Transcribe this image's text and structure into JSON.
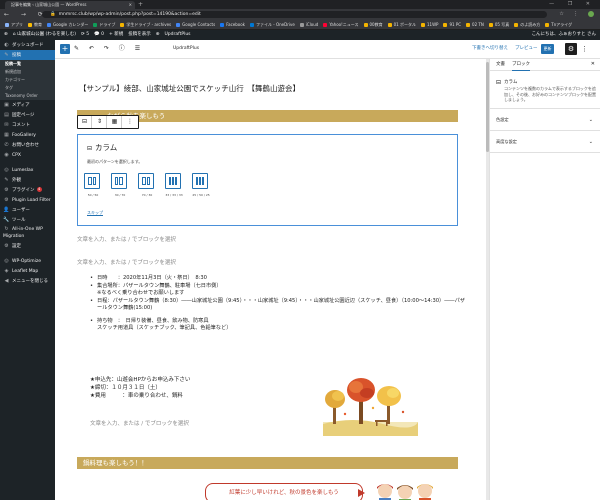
{
  "browser": {
    "tab_title": "記事を編集 ‹ 山家城山公園 — WordPress",
    "tab_close": "×",
    "new_tab": "+",
    "window_controls": "— ❐ ✕",
    "nav": "← → ⟳",
    "url": "mnmrsc.club/wp/wp-admin/post.php?post=14190&action=edit",
    "icons": "☆ ⋮",
    "bookmarks": [
      {
        "label": "アプリ",
        "color": "#8ab4f8"
      },
      {
        "label": "教育",
        "color": "#fbbc04"
      },
      {
        "label": "Google カレンダー",
        "color": "#4285f4"
      },
      {
        "label": "ドライブ",
        "color": "#0f9d58"
      },
      {
        "label": "学生ドライブ - archives",
        "color": "#f4b400"
      },
      {
        "label": "Google Contacts",
        "color": "#4285f4"
      },
      {
        "label": "Facebook",
        "color": "#1877f2"
      },
      {
        "label": "ファイル - OneDrive",
        "color": "#0078d4"
      },
      {
        "label": "iCloud",
        "color": "#999999"
      },
      {
        "label": "Yahoo!ニュース",
        "color": "#ff0033"
      },
      {
        "label": "00教育",
        "color": "#f4b400"
      },
      {
        "label": "01 ポータル",
        "color": "#f4b400"
      },
      {
        "label": "11WP",
        "color": "#f4b400"
      },
      {
        "label": "91 PC",
        "color": "#f4b400"
      },
      {
        "label": "02 TN",
        "color": "#f4b400"
      },
      {
        "label": "05 写真",
        "color": "#f4b400"
      },
      {
        "label": "のよ読み方",
        "color": "#f4b400"
      },
      {
        "label": "Tnアライグ",
        "color": "#f4b400"
      }
    ]
  },
  "adminbar": {
    "items": [
      "⊕",
      "⌂ 山家城山公園 (わるを楽しむ)",
      "⟳ 5",
      "💬 0",
      "+ 新規",
      "投稿を表示",
      "⊕",
      "UpdraftPlus"
    ],
    "greeting": "こんにちは、ふぁおりすと さん"
  },
  "sidebar": {
    "items": [
      {
        "icon": "◐",
        "label": "ダッシュボード",
        "state": "normal"
      },
      {
        "icon": "✎",
        "label": "投稿",
        "state": "active"
      },
      {
        "sub": true,
        "label": "投稿一覧",
        "cur": true
      },
      {
        "sub": true,
        "label": "新規追加"
      },
      {
        "sub": true,
        "label": "カテゴリー"
      },
      {
        "sub": true,
        "label": "タグ"
      },
      {
        "sub": true,
        "label": "Taxonomy Order"
      },
      {
        "icon": "▣",
        "label": "メディア"
      },
      {
        "icon": "▤",
        "label": "固定ページ"
      },
      {
        "icon": "✉",
        "label": "コメント"
      },
      {
        "icon": "▦",
        "label": "FooGallery"
      },
      {
        "icon": "✆",
        "label": "お問い合わせ"
      },
      {
        "icon": "◉",
        "label": "CPX"
      },
      {
        "spacer": true
      },
      {
        "icon": "◎",
        "label": "Lumeslax"
      },
      {
        "icon": "✎",
        "label": "外観"
      },
      {
        "icon": "⚙",
        "label": "プラグイン",
        "badge": "4"
      },
      {
        "icon": "⚙",
        "label": "Plugin Load Filter"
      },
      {
        "icon": "👤",
        "label": "ユーザー"
      },
      {
        "icon": "🔧",
        "label": "ツール"
      },
      {
        "icon": "↻",
        "label": "All-in-One WP Migration",
        "two": true
      },
      {
        "icon": "⚙",
        "label": "設定"
      },
      {
        "spacer": true
      },
      {
        "icon": "◎",
        "label": "WP-Optimize"
      },
      {
        "icon": "◈",
        "label": "Leaflet Map"
      },
      {
        "icon": "◀",
        "label": "メニューを閉じる"
      }
    ]
  },
  "editor_toolbar": {
    "add_label": "+",
    "tools": "✎ ↶ ↷ ⓘ ☰",
    "plugin_label": "UpdraftPlus",
    "save_draft": "下書きへ切り替え",
    "preview": "プレビュー",
    "publish": "更新",
    "settings_icon": "⚙",
    "more_icon": "⋮"
  },
  "content": {
    "page_title": "【サンプル】綾部、山家城址公園でスケッチ山行　【舞鶴山遊会】",
    "heading1": "ながら秋を楽しもう",
    "block_toolbar": [
      "⊟",
      "⇕",
      "▦",
      "⋮"
    ],
    "columns_block": {
      "title": "カラム",
      "icon": "⊟",
      "instructions": "最初のパターンを選択します。",
      "variations": [
        {
          "label": "50 / 50",
          "cols": [
            1,
            1
          ]
        },
        {
          "label": "30 / 70",
          "cols": [
            1,
            2
          ]
        },
        {
          "label": "70 / 30",
          "cols": [
            2,
            1
          ]
        },
        {
          "label": "33 / 33 / 33",
          "cols": [
            1,
            1,
            1
          ]
        },
        {
          "label": "25 / 50 / 25",
          "cols": [
            1,
            2,
            1
          ]
        }
      ],
      "skip": "スキップ"
    },
    "placeholder": "文章を入力、または / でブロックを選択",
    "list": [
      {
        "text": "日時　　：2020年11月3日（火・祭日）　8:30",
        "bullet": true
      },
      {
        "text": "集合場所：パザールタウン舞鶴、駐車場（七日市側）",
        "bullet": true
      },
      {
        "text": "※なるべく乗り合わせでお願いします",
        "bullet": false
      },
      {
        "text": "日程：パザールタウン舞鶴（8:30）――山家城址公園（9:45）・・・山家城址（9:45）・・・山家城址公園近辺（スケッチ、昼食）（10:00～14:30）――パザールタウン舞鶴(15:00)",
        "bullet": true
      },
      {
        "gap": true
      },
      {
        "text": "持ち物　：　日帰り装備、昼食、飲み物、防寒具",
        "bullet": true
      },
      {
        "text": "スケッチ用道具（スケッチブック、筆記具、色鉛筆など）",
        "bullet": false
      }
    ],
    "notes": [
      "★申込先：山遊会HPからお申込み下さい",
      "★締切：１０月３１日（土）",
      "★費用　　　：車の乗り合わせ、鍋料"
    ],
    "heading2": "鍋料理も楽しもう！！",
    "bubble": "紅葉に少し早いけれど、秋の景色を楽しもう"
  },
  "settings_panel": {
    "tabs": [
      "文書",
      "ブロック"
    ],
    "close": "✕",
    "block_name": "カラム",
    "block_icon": "⊟",
    "block_desc": "コンテンツを複数のカラムで表示するブロックを追加し、その後、お好みのコンテンツブロックを配置しましょう。",
    "panels": [
      "色設定",
      "高度な設定"
    ],
    "chevron": "⌄"
  },
  "colors": {
    "accent": "#2271b1",
    "heading_gold": "#c8a95b",
    "admin_dark": "#1d2327",
    "bubble_red": "#c0392b"
  }
}
